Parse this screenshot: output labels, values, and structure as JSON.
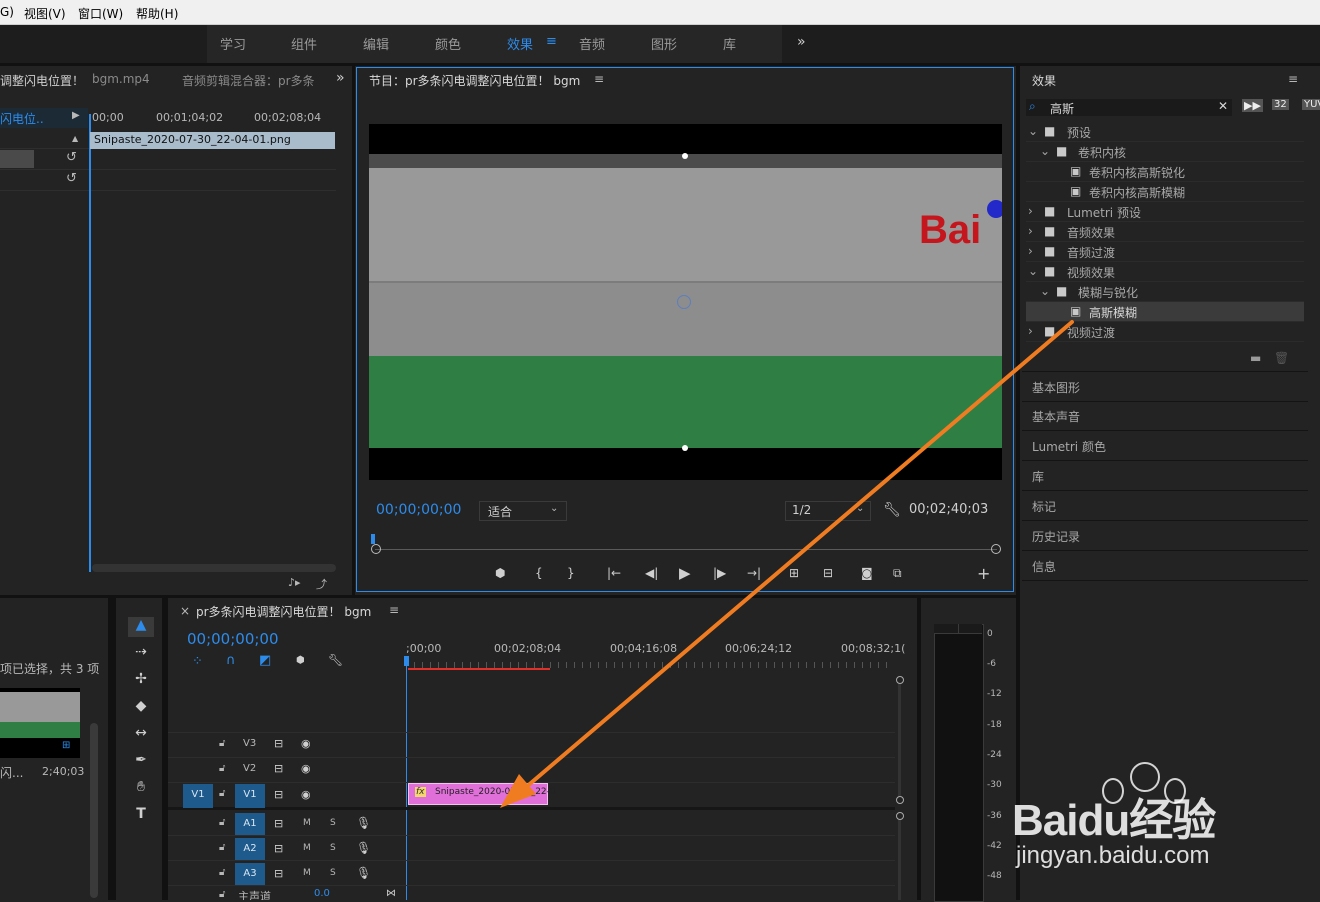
{
  "menu": [
    "G)",
    "视图(V)",
    "窗口(W)",
    "帮助(H)"
  ],
  "workspaces": [
    "学习",
    "组件",
    "编辑",
    "颜色",
    "效果",
    "音频",
    "图形",
    "库"
  ],
  "active_workspace": "效果",
  "source_panel": {
    "tabs": [
      "调整闪电位置！",
      "bgm.mp4",
      "音频剪辑混合器：pr多条"
    ],
    "track_label": "闪电位..",
    "ruler": [
      "00;00",
      "00;01;04;02",
      "00;02;08;04"
    ],
    "clip_name": "Snipaste_2020-07-30_22-04-01.png"
  },
  "program": {
    "title": "节目：pr多条闪电调整闪电位置！ bgm",
    "timecode": "00;00;00;00",
    "fit": "适合",
    "resolution": "1/2",
    "duration": "00;02;40;03",
    "logo_text": "Bai"
  },
  "effects": {
    "title": "效果",
    "search": "高斯",
    "tree": [
      {
        "label": "预设",
        "indent": 0,
        "expanded": true
      },
      {
        "label": "卷积内核",
        "indent": 1,
        "expanded": true
      },
      {
        "label": "卷积内核高斯锐化",
        "indent": 2
      },
      {
        "label": "卷积内核高斯模糊",
        "indent": 2
      },
      {
        "label": "Lumetri 预设",
        "indent": 0,
        "expanded": false
      },
      {
        "label": "音频效果",
        "indent": 0,
        "expanded": false
      },
      {
        "label": "音频过渡",
        "indent": 0,
        "expanded": false
      },
      {
        "label": "视频效果",
        "indent": 0,
        "expanded": true
      },
      {
        "label": "模糊与锐化",
        "indent": 1,
        "expanded": true
      },
      {
        "label": "高斯模糊",
        "indent": 2,
        "selected": true
      },
      {
        "label": "视频过渡",
        "indent": 0,
        "expanded": false
      }
    ]
  },
  "side_panels": [
    "基本图形",
    "基本声音",
    "Lumetri 颜色",
    "库",
    "标记",
    "历史记录",
    "信息"
  ],
  "project": {
    "selection": "项已选择，共 3 项",
    "item_name": "闪...",
    "item_duration": "2;40;03"
  },
  "timeline": {
    "title": "pr多条闪电调整闪电位置！ bgm",
    "timecode": "00;00;00;00",
    "ruler": [
      ";00;00",
      "00;02;08;04",
      "00;04;16;08",
      "00;06;24;12",
      "00;08;32;1("
    ],
    "tracks": [
      "V3",
      "V2",
      "V1",
      "A1",
      "A2",
      "A3"
    ],
    "source_patch": "V1",
    "mixer_label": "主声道",
    "mixer_value": "0.0",
    "clip_name": "Snipaste_2020-07-30_22-0",
    "fx_badge": "fx"
  },
  "meter_ticks": [
    "0",
    "-6",
    "-12",
    "-18",
    "-24",
    "-30",
    "-36",
    "-42",
    "-48"
  ],
  "watermark": {
    "brand": "Baidu经验",
    "url": "jingyan.baidu.com"
  },
  "colors": {
    "accent": "#2d8ceb",
    "arrow": "#f07c21",
    "clip": "#e06fd9",
    "playhead_red": "#e0302a"
  }
}
